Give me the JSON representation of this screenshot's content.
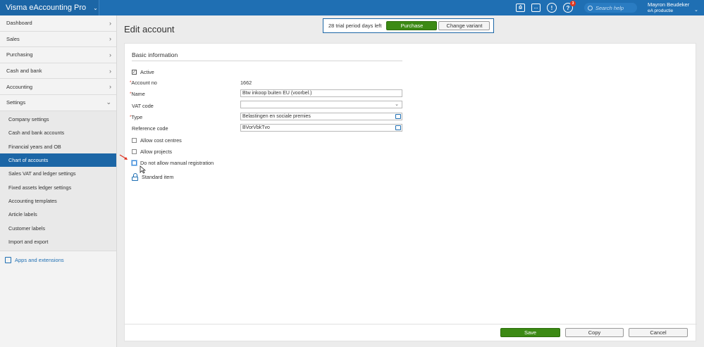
{
  "app": {
    "title": "Visma eAccounting Pro",
    "search_placeholder": "Search help",
    "user_name": "Mayron Beudeker",
    "user_company": "eA productie",
    "notification_count": "3"
  },
  "sidebar": {
    "items": [
      {
        "label": "Dashboard"
      },
      {
        "label": "Sales"
      },
      {
        "label": "Purchasing"
      },
      {
        "label": "Cash and bank"
      },
      {
        "label": "Accounting"
      },
      {
        "label": "Settings"
      }
    ],
    "settings_sub": [
      {
        "label": "Company settings"
      },
      {
        "label": "Cash and bank accounts"
      },
      {
        "label": "Financial years and OB"
      },
      {
        "label": "Chart of accounts"
      },
      {
        "label": "Sales VAT and ledger settings"
      },
      {
        "label": "Fixed assets ledger settings"
      },
      {
        "label": "Accounting templates"
      },
      {
        "label": "Article labels"
      },
      {
        "label": "Customer labels"
      },
      {
        "label": "Import and export"
      }
    ],
    "active_sub": "Chart of accounts",
    "apps_label": "Apps and extensions"
  },
  "page": {
    "title": "Edit account"
  },
  "trial": {
    "text": "28 trial period days left",
    "purchase_label": "Purchase",
    "change_variant_label": "Change variant"
  },
  "form": {
    "section_title": "Basic information",
    "active_label": "Active",
    "active_checked": true,
    "account_no_label": "Account no",
    "account_no_value": "1662",
    "name_label": "Name",
    "name_value": "Btw inkoop buiten EU (voorbel.)",
    "vat_code_label": "VAT code",
    "vat_code_value": "",
    "type_label": "Type",
    "type_value": "Belastingen en sociale premies",
    "reference_code_label": "Reference code",
    "reference_code_value": "BVorVbkTvo",
    "allow_cost_centres_label": "Allow cost centres",
    "allow_projects_label": "Allow projects",
    "no_manual_reg_label": "Do not allow manual registration",
    "standard_item_label": "Standard item",
    "required_marker": "*"
  },
  "footer": {
    "save_label": "Save",
    "copy_label": "Copy",
    "cancel_label": "Cancel"
  },
  "colors": {
    "topbar": "#1f6fb3",
    "active": "#1c66a6",
    "primary_button": "#3c8a14",
    "required": "#d9321f"
  }
}
